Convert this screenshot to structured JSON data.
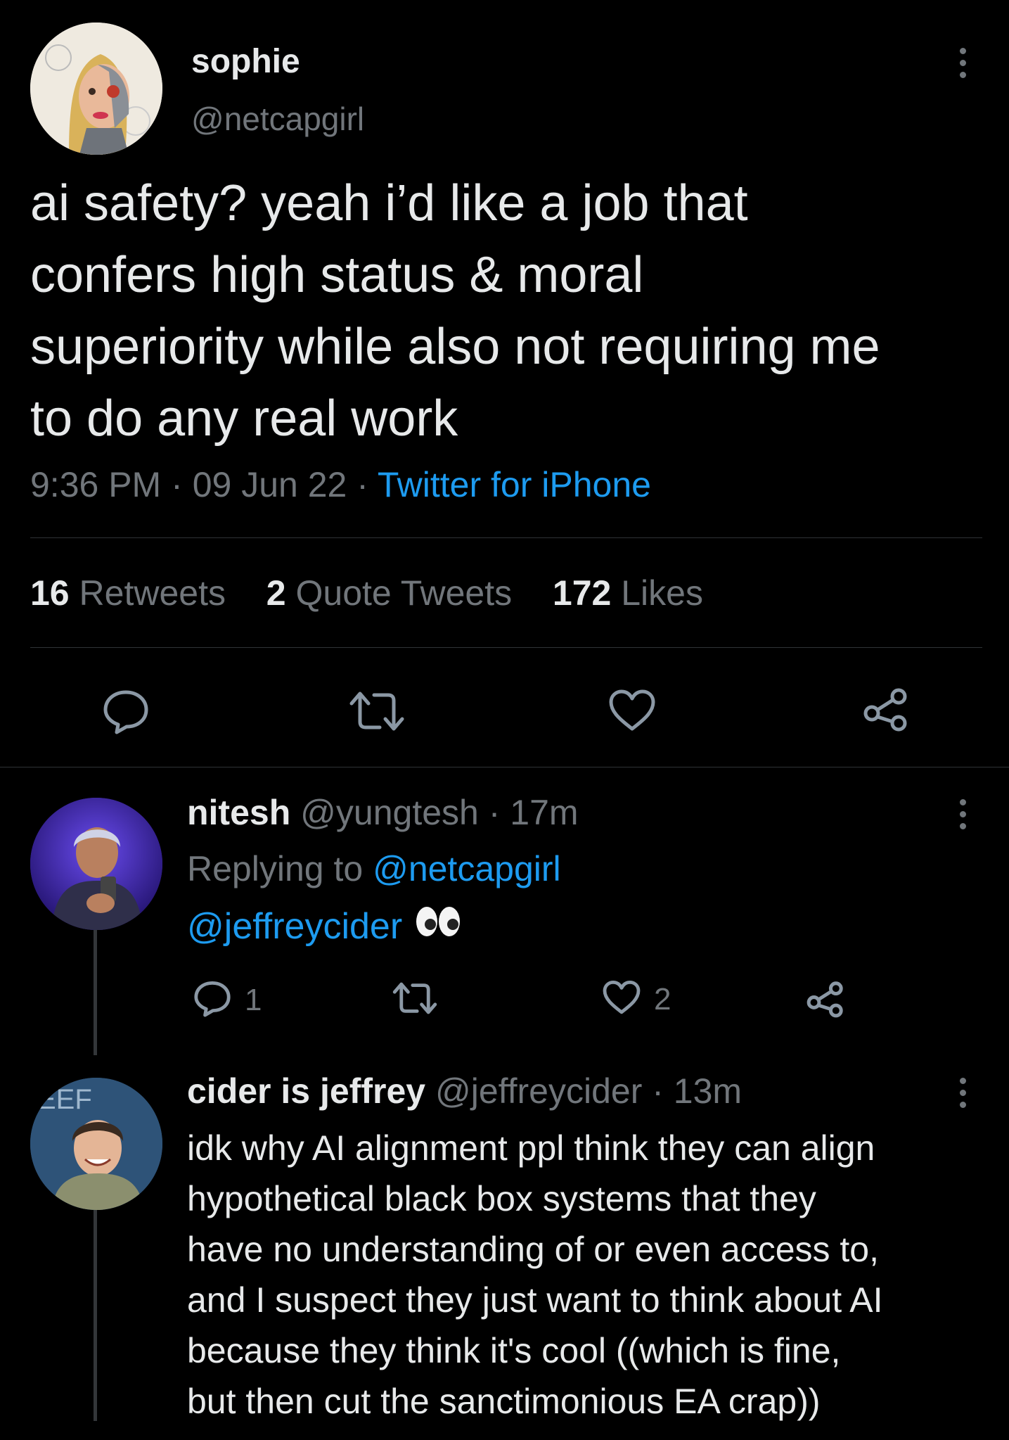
{
  "main_tweet": {
    "display_name": "sophie",
    "handle": "@netcapgirl",
    "text_lines": [
      "ai safety? yeah i’d like a job that",
      "confers high status & moral",
      "superiority while also not requiring me",
      "to do any real work"
    ],
    "time": "9:36 PM",
    "sep1": "·",
    "date": "09 Jun 22",
    "sep2": "·",
    "source": "Twitter for iPhone",
    "stats": {
      "retweets_count": "16",
      "retweets_label": "Retweets",
      "quotes_count": "2",
      "quotes_label": "Quote Tweets",
      "likes_count": "172",
      "likes_label": "Likes"
    },
    "actions": [
      "reply-icon",
      "retweet-icon",
      "like-icon",
      "share-icon"
    ]
  },
  "reply1": {
    "display_name": "nitesh",
    "handle": "@yungtesh",
    "time": "· 17m",
    "replying_prefix": "Replying to",
    "replying_handle": "@netcapgirl",
    "mention": "@jeffreycider",
    "emoji": "eyes-emoji",
    "reply_count": "1",
    "like_count": "2"
  },
  "reply2": {
    "display_name": "cider is jeffrey",
    "handle": "@jeffreycider",
    "time": "· 13m",
    "text_lines": [
      "idk why AI alignment ppl think they can align",
      "hypothetical black box systems that they",
      "have no understanding of or even access to,",
      "and I suspect they just want to think about AI",
      "because they think it's cool ((which is fine,",
      "but then cut the sanctimonious EA crap))"
    ]
  },
  "colors": {
    "background": "#000000",
    "text": "#e7e9ea",
    "muted": "#71767b",
    "link": "#1d9bf0",
    "divider": "#2f3336"
  }
}
